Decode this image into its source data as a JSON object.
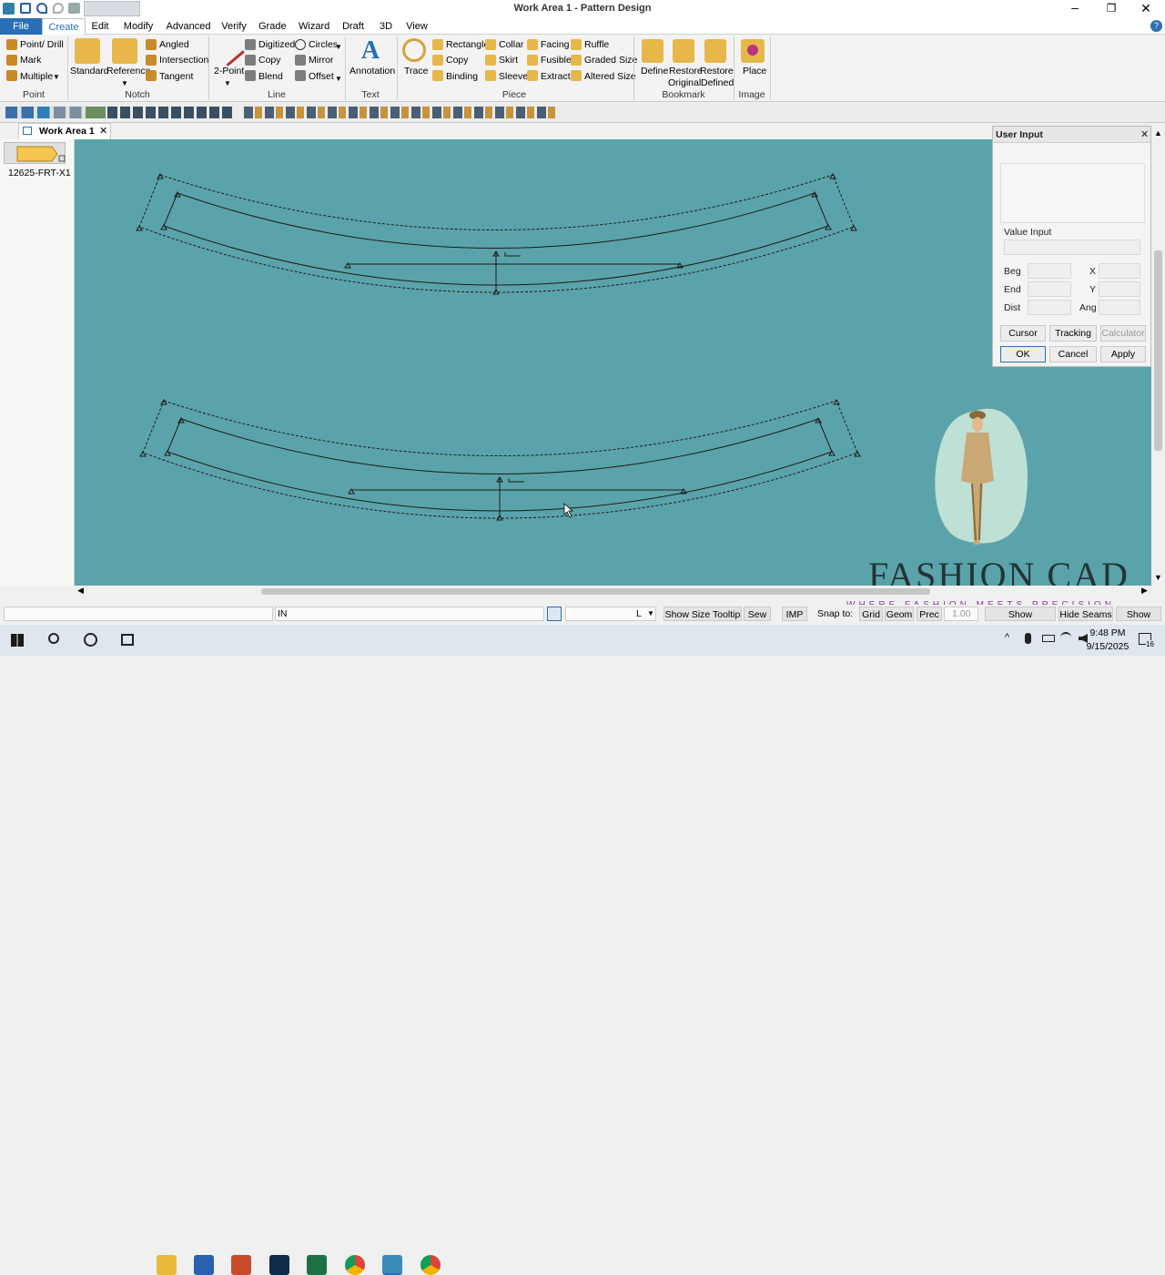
{
  "window": {
    "title": "Work Area 1 - Pattern Design"
  },
  "menu": {
    "file": "File",
    "create": "Create",
    "edit": "Edit",
    "modify": "Modify",
    "advanced": "Advanced",
    "verify": "Verify",
    "grade": "Grade",
    "wizard": "Wizard",
    "draft": "Draft",
    "3d": "3D",
    "view": "View"
  },
  "ribbon": {
    "point": {
      "point_drill": "Point/ Drill",
      "mark": "Mark",
      "multiple": "Multiple",
      "group": "Point"
    },
    "notch": {
      "standard": "Standard",
      "reference": "Reference",
      "angled": "Angled",
      "intersection": "Intersection",
      "tangent": "Tangent",
      "group": "Notch"
    },
    "line": {
      "two_point": "2-Point",
      "digitized": "Digitized",
      "copy": "Copy",
      "blend": "Blend",
      "circles": "Circles",
      "mirror": "Mirror",
      "offset": "Offset",
      "group": "Line"
    },
    "text": {
      "annotation": "Annotation",
      "group": "Text"
    },
    "piece": {
      "trace": "Trace",
      "rectangle": "Rectangle",
      "copy": "Copy",
      "binding": "Binding",
      "collar": "Collar",
      "skirt": "Skirt",
      "sleeve": "Sleeve",
      "facing": "Facing",
      "fusible": "Fusible",
      "extract": "Extract",
      "ruffle": "Ruffle",
      "graded_size": "Graded Size",
      "altered_size": "Altered Size",
      "group": "Piece"
    },
    "bookmark": {
      "define": "Define",
      "restore_original_1": "Restore",
      "restore_original_2": "Original",
      "restore_defined_1": "Restore",
      "restore_defined_2": "Defined",
      "group": "Bookmark"
    },
    "image": {
      "place": "Place",
      "group": "Image"
    }
  },
  "work_tab": {
    "label": "Work Area 1"
  },
  "piece_list": {
    "item": "12625-FRT-X1"
  },
  "user_input": {
    "title": "User Input",
    "value_input": "Value Input",
    "beg": "Beg",
    "end": "End",
    "dist": "Dist",
    "x": "X",
    "y": "Y",
    "ang": "Ang",
    "cursor": "Cursor",
    "tracking": "Tracking",
    "calculator": "Calculator",
    "ok": "OK",
    "cancel": "Cancel",
    "apply": "Apply"
  },
  "watermark": {
    "brand": "FASHION CAD",
    "tagline": "WHERE FASHION MEETS PRECISION"
  },
  "status": {
    "units": "IN",
    "size": "L",
    "show_size_tooltip": "Show Size Tooltip",
    "sew": "Sew",
    "imp": "IMP",
    "snap_to": "Snap to:",
    "grid": "Grid",
    "geom": "Geom",
    "prec": "Prec",
    "prec_value": "1.00",
    "show_smoothing": "Show Smoothing",
    "hide_seams": "Hide Seams",
    "show_grid": "Show Grid"
  },
  "taskbar": {
    "time": "9:48 PM",
    "date": "9/15/2025",
    "notification_count": "16"
  }
}
